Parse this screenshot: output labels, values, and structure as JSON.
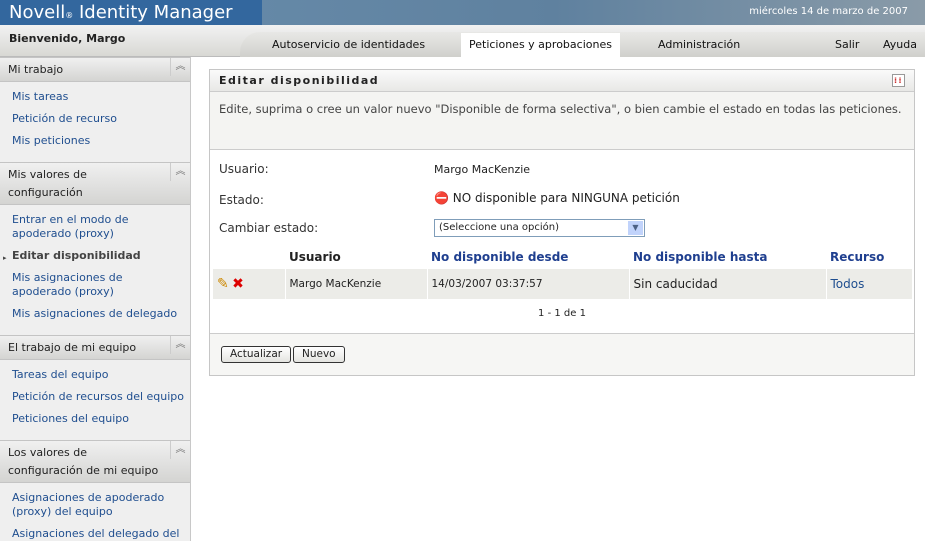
{
  "header": {
    "brand": "Novell",
    "reg": "®",
    "product": "Identity Manager",
    "date": "miércoles 14 de marzo de 2007",
    "welcome": "Bienvenido, Margo"
  },
  "tabs": [
    "Autoservicio de identidades",
    "Peticiones y aprobaciones",
    "Administración"
  ],
  "links": {
    "logout": "Salir",
    "help": "Ayuda"
  },
  "sidebar": [
    {
      "title": "Mi trabajo",
      "items": [
        "Mis tareas",
        "Petición de recurso",
        "Mis peticiones"
      ]
    },
    {
      "title": "Mis valores de configuración",
      "items": [
        "Entrar en el modo de apoderado (proxy)",
        "Editar disponibilidad",
        "Mis asignaciones de apoderado (proxy)",
        "Mis asignaciones de delegado"
      ]
    },
    {
      "title": "El trabajo de mi equipo",
      "items": [
        "Tareas del equipo",
        "Petición de recursos del equipo",
        "Peticiones del equipo"
      ]
    },
    {
      "title": "Los valores de configuración de mi equipo",
      "items": [
        "Asignaciones de apoderado (proxy) del equipo",
        "Asignaciones del delegado del"
      ]
    }
  ],
  "panel": {
    "title": "Editar disponibilidad",
    "description": "Edite, suprima o cree un valor nuevo \"Disponible de forma selectiva\", o bien cambie el estado en todas las peticiones.",
    "user_label": "Usuario:",
    "user_value": "Margo MacKenzie",
    "status_label": "Estado:",
    "status_value": "NO disponible para NINGUNA petición",
    "change_label": "Cambiar estado:",
    "change_value": "(Seleccione una opción)",
    "columns": [
      "Usuario",
      "No disponible desde",
      "No disponible hasta",
      "Recurso"
    ],
    "rows": [
      {
        "user": "Margo MacKenzie",
        "from": "14/03/2007 03:37:57",
        "to": "Sin caducidad",
        "resource": "Todos"
      }
    ],
    "pagination": "1 - 1 de 1",
    "refresh": "Actualizar",
    "new": "Nuevo"
  }
}
